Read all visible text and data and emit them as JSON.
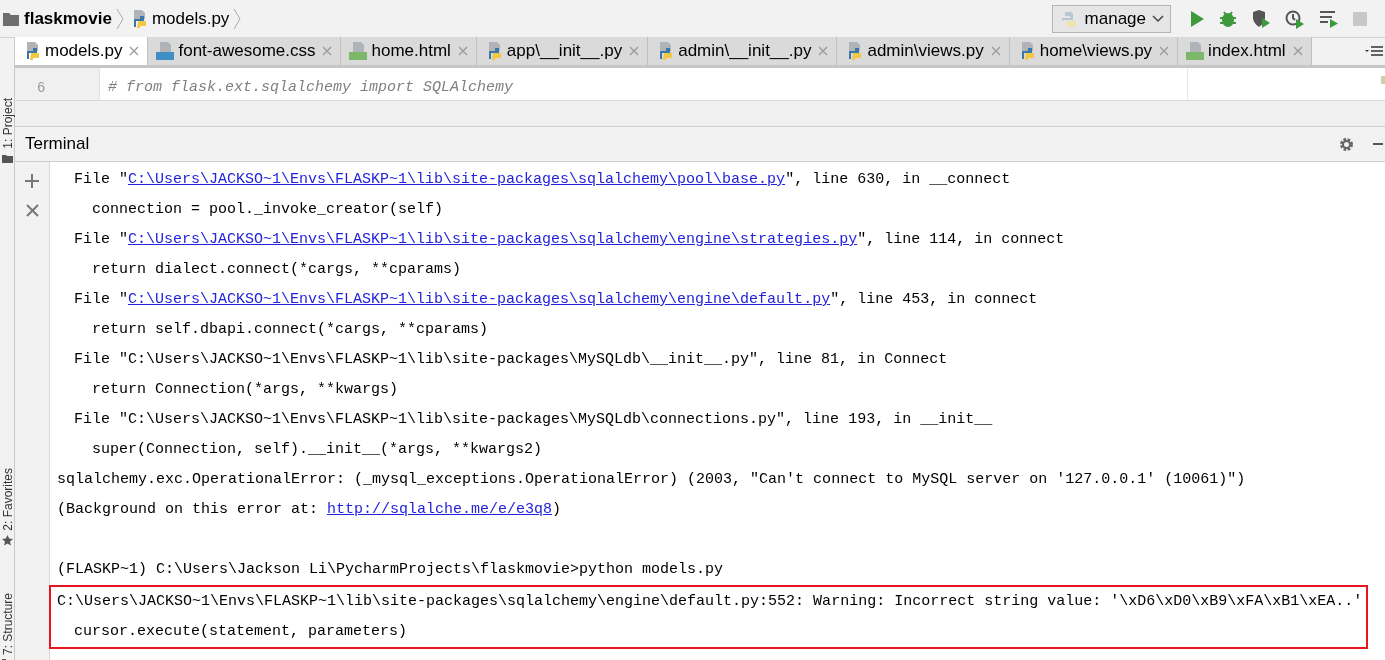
{
  "breadcrumb": [
    {
      "label": "flaskmovie",
      "kind": "folder"
    },
    {
      "label": "models.py",
      "kind": "python"
    }
  ],
  "run_config": {
    "label": "manage"
  },
  "tabs": [
    {
      "label": "models.py",
      "kind": "python",
      "selected": true
    },
    {
      "label": "font-awesome.css",
      "kind": "css",
      "selected": false
    },
    {
      "label": "home.html",
      "kind": "html",
      "selected": false
    },
    {
      "label": "app\\__init__.py",
      "kind": "python",
      "selected": false
    },
    {
      "label": "admin\\__init__.py",
      "kind": "python",
      "selected": false
    },
    {
      "label": "admin\\views.py",
      "kind": "python",
      "selected": false
    },
    {
      "label": "home\\views.py",
      "kind": "python",
      "selected": false
    },
    {
      "label": "index.html",
      "kind": "html",
      "selected": false
    }
  ],
  "editor": {
    "lines": [
      {
        "number": "6",
        "text": "# from flask.ext.sqlalchemy import SQLAlchemy"
      }
    ]
  },
  "side_tools": [
    {
      "label": "1: Project",
      "kind": "folder"
    },
    {
      "label": "2: Favorites",
      "kind": "star"
    },
    {
      "label": "7: Structure",
      "kind": "structure"
    }
  ],
  "terminal": {
    "title": "Terminal",
    "lines": [
      {
        "kind": "frame",
        "highlighted": false,
        "parts": [
          {
            "text": "File \"",
            "link": false
          },
          {
            "text": "C:\\Users\\JACKSO~1\\Envs\\FLASKP~1\\lib\\site-packages\\sqlalchemy\\pool\\base.py",
            "link": true
          },
          {
            "text": "\", line 630, in __connect",
            "link": false
          }
        ]
      },
      {
        "kind": "code",
        "highlighted": false,
        "parts": [
          {
            "text": "connection = pool._invoke_creator(self)",
            "link": false
          }
        ]
      },
      {
        "kind": "frame",
        "highlighted": false,
        "parts": [
          {
            "text": "File \"",
            "link": false
          },
          {
            "text": "C:\\Users\\JACKSO~1\\Envs\\FLASKP~1\\lib\\site-packages\\sqlalchemy\\engine\\strategies.py",
            "link": true
          },
          {
            "text": "\", line 114, in connect",
            "link": false
          }
        ]
      },
      {
        "kind": "code",
        "highlighted": false,
        "parts": [
          {
            "text": "return dialect.connect(*cargs, **cparams)",
            "link": false
          }
        ]
      },
      {
        "kind": "frame",
        "highlighted": false,
        "parts": [
          {
            "text": "File \"",
            "link": false
          },
          {
            "text": "C:\\Users\\JACKSO~1\\Envs\\FLASKP~1\\lib\\site-packages\\sqlalchemy\\engine\\default.py",
            "link": true
          },
          {
            "text": "\", line 453, in connect",
            "link": false
          }
        ]
      },
      {
        "kind": "code",
        "highlighted": false,
        "parts": [
          {
            "text": "return self.dbapi.connect(*cargs, **cparams)",
            "link": false
          }
        ]
      },
      {
        "kind": "frame",
        "highlighted": false,
        "parts": [
          {
            "text": "File \"C:\\Users\\JACKSO~1\\Envs\\FLASKP~1\\lib\\site-packages\\MySQLdb\\__init__.py\", line 81, in Connect",
            "link": false
          }
        ]
      },
      {
        "kind": "code",
        "highlighted": false,
        "parts": [
          {
            "text": "return Connection(*args, **kwargs)",
            "link": false
          }
        ]
      },
      {
        "kind": "frame",
        "highlighted": false,
        "parts": [
          {
            "text": "File \"C:\\Users\\JACKSO~1\\Envs\\FLASKP~1\\lib\\site-packages\\MySQLdb\\connections.py\", line 193, in __init__",
            "link": false
          }
        ]
      },
      {
        "kind": "code",
        "highlighted": false,
        "parts": [
          {
            "text": "super(Connection, self).__init__(*args, **kwargs2)",
            "link": false
          }
        ]
      },
      {
        "kind": "plain",
        "highlighted": false,
        "parts": [
          {
            "text": "sqlalchemy.exc.OperationalError: (_mysql_exceptions.OperationalError) (2003, \"Can't connect to MySQL server on '127.0.0.1' (10061)\")",
            "link": false
          }
        ]
      },
      {
        "kind": "plain",
        "highlighted": false,
        "parts": [
          {
            "text": "(Background on this error at: ",
            "link": false
          },
          {
            "text": "http://sqlalche.me/e/e3q8",
            "link": true
          },
          {
            "text": ")",
            "link": false
          }
        ]
      },
      {
        "kind": "blank",
        "highlighted": false
      },
      {
        "kind": "plain",
        "highlighted": false,
        "parts": [
          {
            "text": "(FLASKP~1) C:\\Users\\Jackson Li\\PycharmProjects\\flaskmovie>python models.py",
            "link": false
          }
        ]
      },
      {
        "kind": "plain",
        "highlighted": true,
        "parts": [
          {
            "text": "C:\\Users\\JACKSO~1\\Envs\\FLASKP~1\\lib\\site-packages\\sqlalchemy\\engine\\default.py:552: Warning: Incorrect string value: '\\xD6\\xD0\\xB9\\xFA\\xB1\\xEA..'",
            "link": false
          }
        ]
      },
      {
        "kind": "frame",
        "highlighted": true,
        "parts": [
          {
            "text": "cursor.execute(statement, parameters)",
            "link": false
          }
        ]
      }
    ]
  }
}
